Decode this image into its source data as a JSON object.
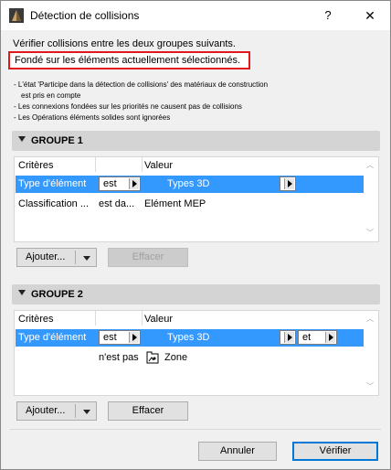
{
  "window": {
    "title": "Détection de collisions",
    "help": "?",
    "close": "✕"
  },
  "intro": "Vérifier collisions entre les deux groupes suivants.",
  "highlighted": "Fondé sur les éléments actuellement sélectionnés.",
  "notes": [
    "- L'état 'Participe dans la détection de collisions' des matériaux de construction",
    "est pris en compte",
    "- Les connexions fondées sur les priorités ne causent pas de collisions",
    "- Les Opérations éléments solides sont ignorées"
  ],
  "group1": {
    "title": "GROUPE 1",
    "headers": {
      "criteria": "Critères",
      "value": "Valeur"
    },
    "rows": [
      {
        "criteria": "Type d'élément",
        "operator": "est",
        "value": "Types 3D"
      },
      {
        "criteria": "Classification ...",
        "operator": "est da...",
        "value": "Elément MEP"
      }
    ],
    "add_label": "Ajouter...",
    "clear_label": "Effacer"
  },
  "group2": {
    "title": "GROUPE 2",
    "headers": {
      "criteria": "Critères",
      "value": "Valeur"
    },
    "rows": [
      {
        "criteria": "Type d'élément",
        "operator": "est",
        "value": "Types 3D",
        "logic": "et"
      },
      {
        "criteria": "",
        "operator": "n'est pas",
        "value": "Zone"
      }
    ],
    "add_label": "Ajouter...",
    "clear_label": "Effacer"
  },
  "footer": {
    "cancel_label": "Annuler",
    "check_label": "Vérifier"
  },
  "colors": {
    "selection": "#3399ff",
    "highlight_border": "#e0191f",
    "primary_border": "#0078d7"
  },
  "icons": [
    "app-icon",
    "close-icon",
    "help-icon",
    "disclosure-triangle-icon",
    "dropdown-arrow-icon",
    "zone-icon",
    "scroll-up-icon",
    "scroll-down-icon"
  ]
}
